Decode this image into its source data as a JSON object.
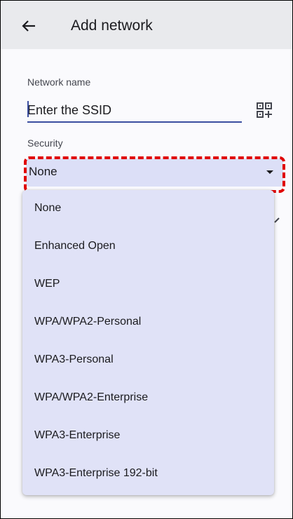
{
  "appbar": {
    "title": "Add network",
    "back_icon": "arrow-left-icon"
  },
  "network_name": {
    "label": "Network name",
    "placeholder": "Enter the SSID",
    "value": "",
    "scan_icon": "qr-code-scan-icon"
  },
  "security": {
    "label": "Security",
    "selected": "None",
    "arrow_icon": "dropdown-arrow-icon",
    "options": [
      "None",
      "Enhanced Open",
      "WEP",
      "WPA/WPA2-Personal",
      "WPA3-Personal",
      "WPA/WPA2-Enterprise",
      "WPA3-Enterprise",
      "WPA3-Enterprise 192-bit"
    ]
  },
  "colors": {
    "appbar_bg": "#e9eaed",
    "page_bg": "#fafafd",
    "accent": "#3b4ea0",
    "select_bg": "#dcdff7",
    "menu_bg": "#e0e2f7",
    "highlight": "#e00000"
  }
}
